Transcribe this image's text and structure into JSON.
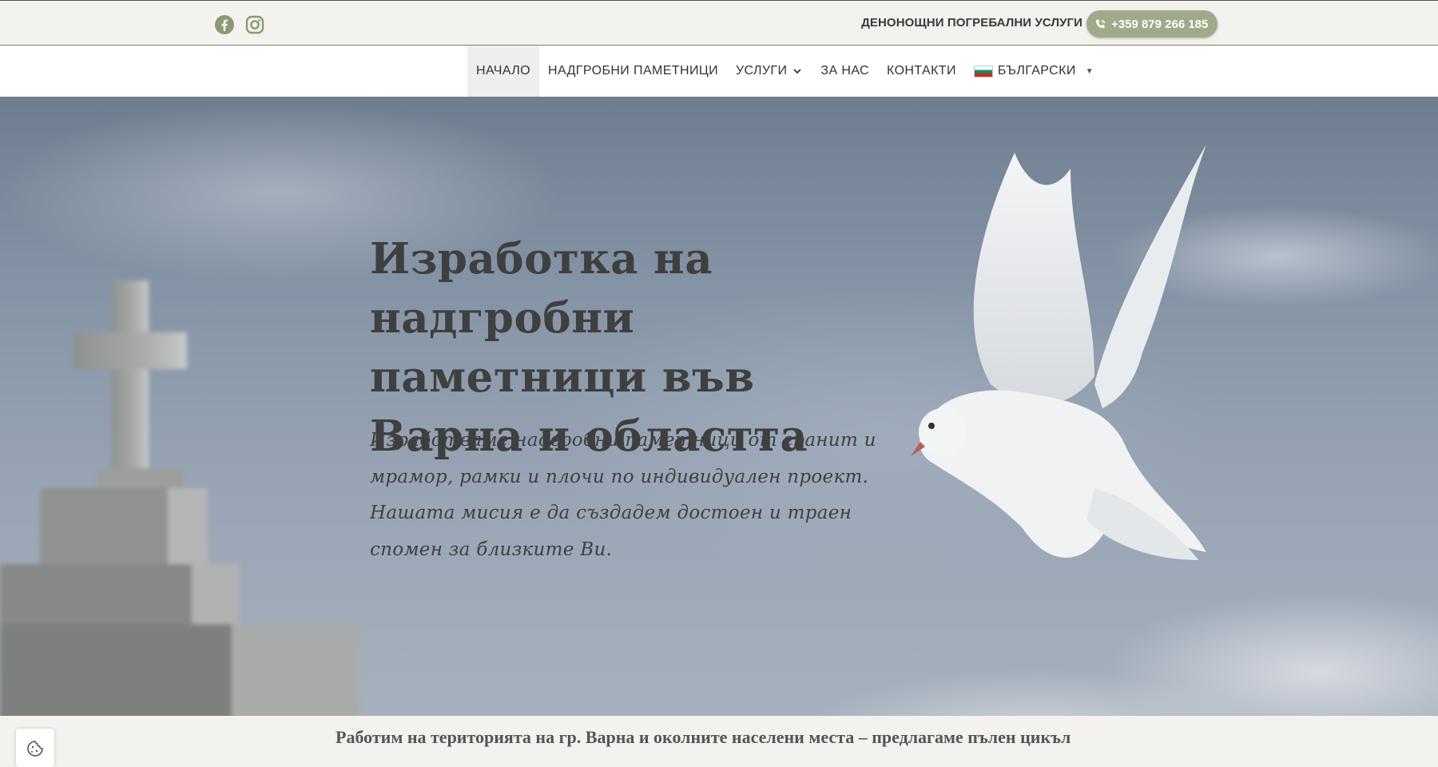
{
  "topbar": {
    "social": [
      {
        "name": "facebook-icon"
      },
      {
        "name": "instagram-icon"
      }
    ],
    "contact_label": "ДЕНОНОЩНИ ПОГРЕБАЛНИ УСЛУГИ",
    "phone": "+359 879 266 185",
    "phone_color": "#9faa8a"
  },
  "nav": {
    "items": [
      {
        "label": "НАЧАЛО",
        "active": true
      },
      {
        "label": "НАДГРОБНИ ПАМЕТНИЦИ"
      },
      {
        "label": "УСЛУГИ",
        "has_dropdown": true
      },
      {
        "label": "ЗА НАС"
      },
      {
        "label": "КОНТАКТИ"
      }
    ],
    "language": "БЪЛГАРСКИ"
  },
  "hero": {
    "title": "Изработка на надгробни паметници във Варна и областта",
    "text": "Изработваме надгробни паметници от гранит и мрамор, рамки и плочи по индивидуален проект. Нашата мисия е да създадем достоен и траен спомен за близките Ви."
  },
  "bottom": {
    "text": "Работим на територията на гр. Варна и околните населени места – предлагаме пълен цикъл"
  }
}
